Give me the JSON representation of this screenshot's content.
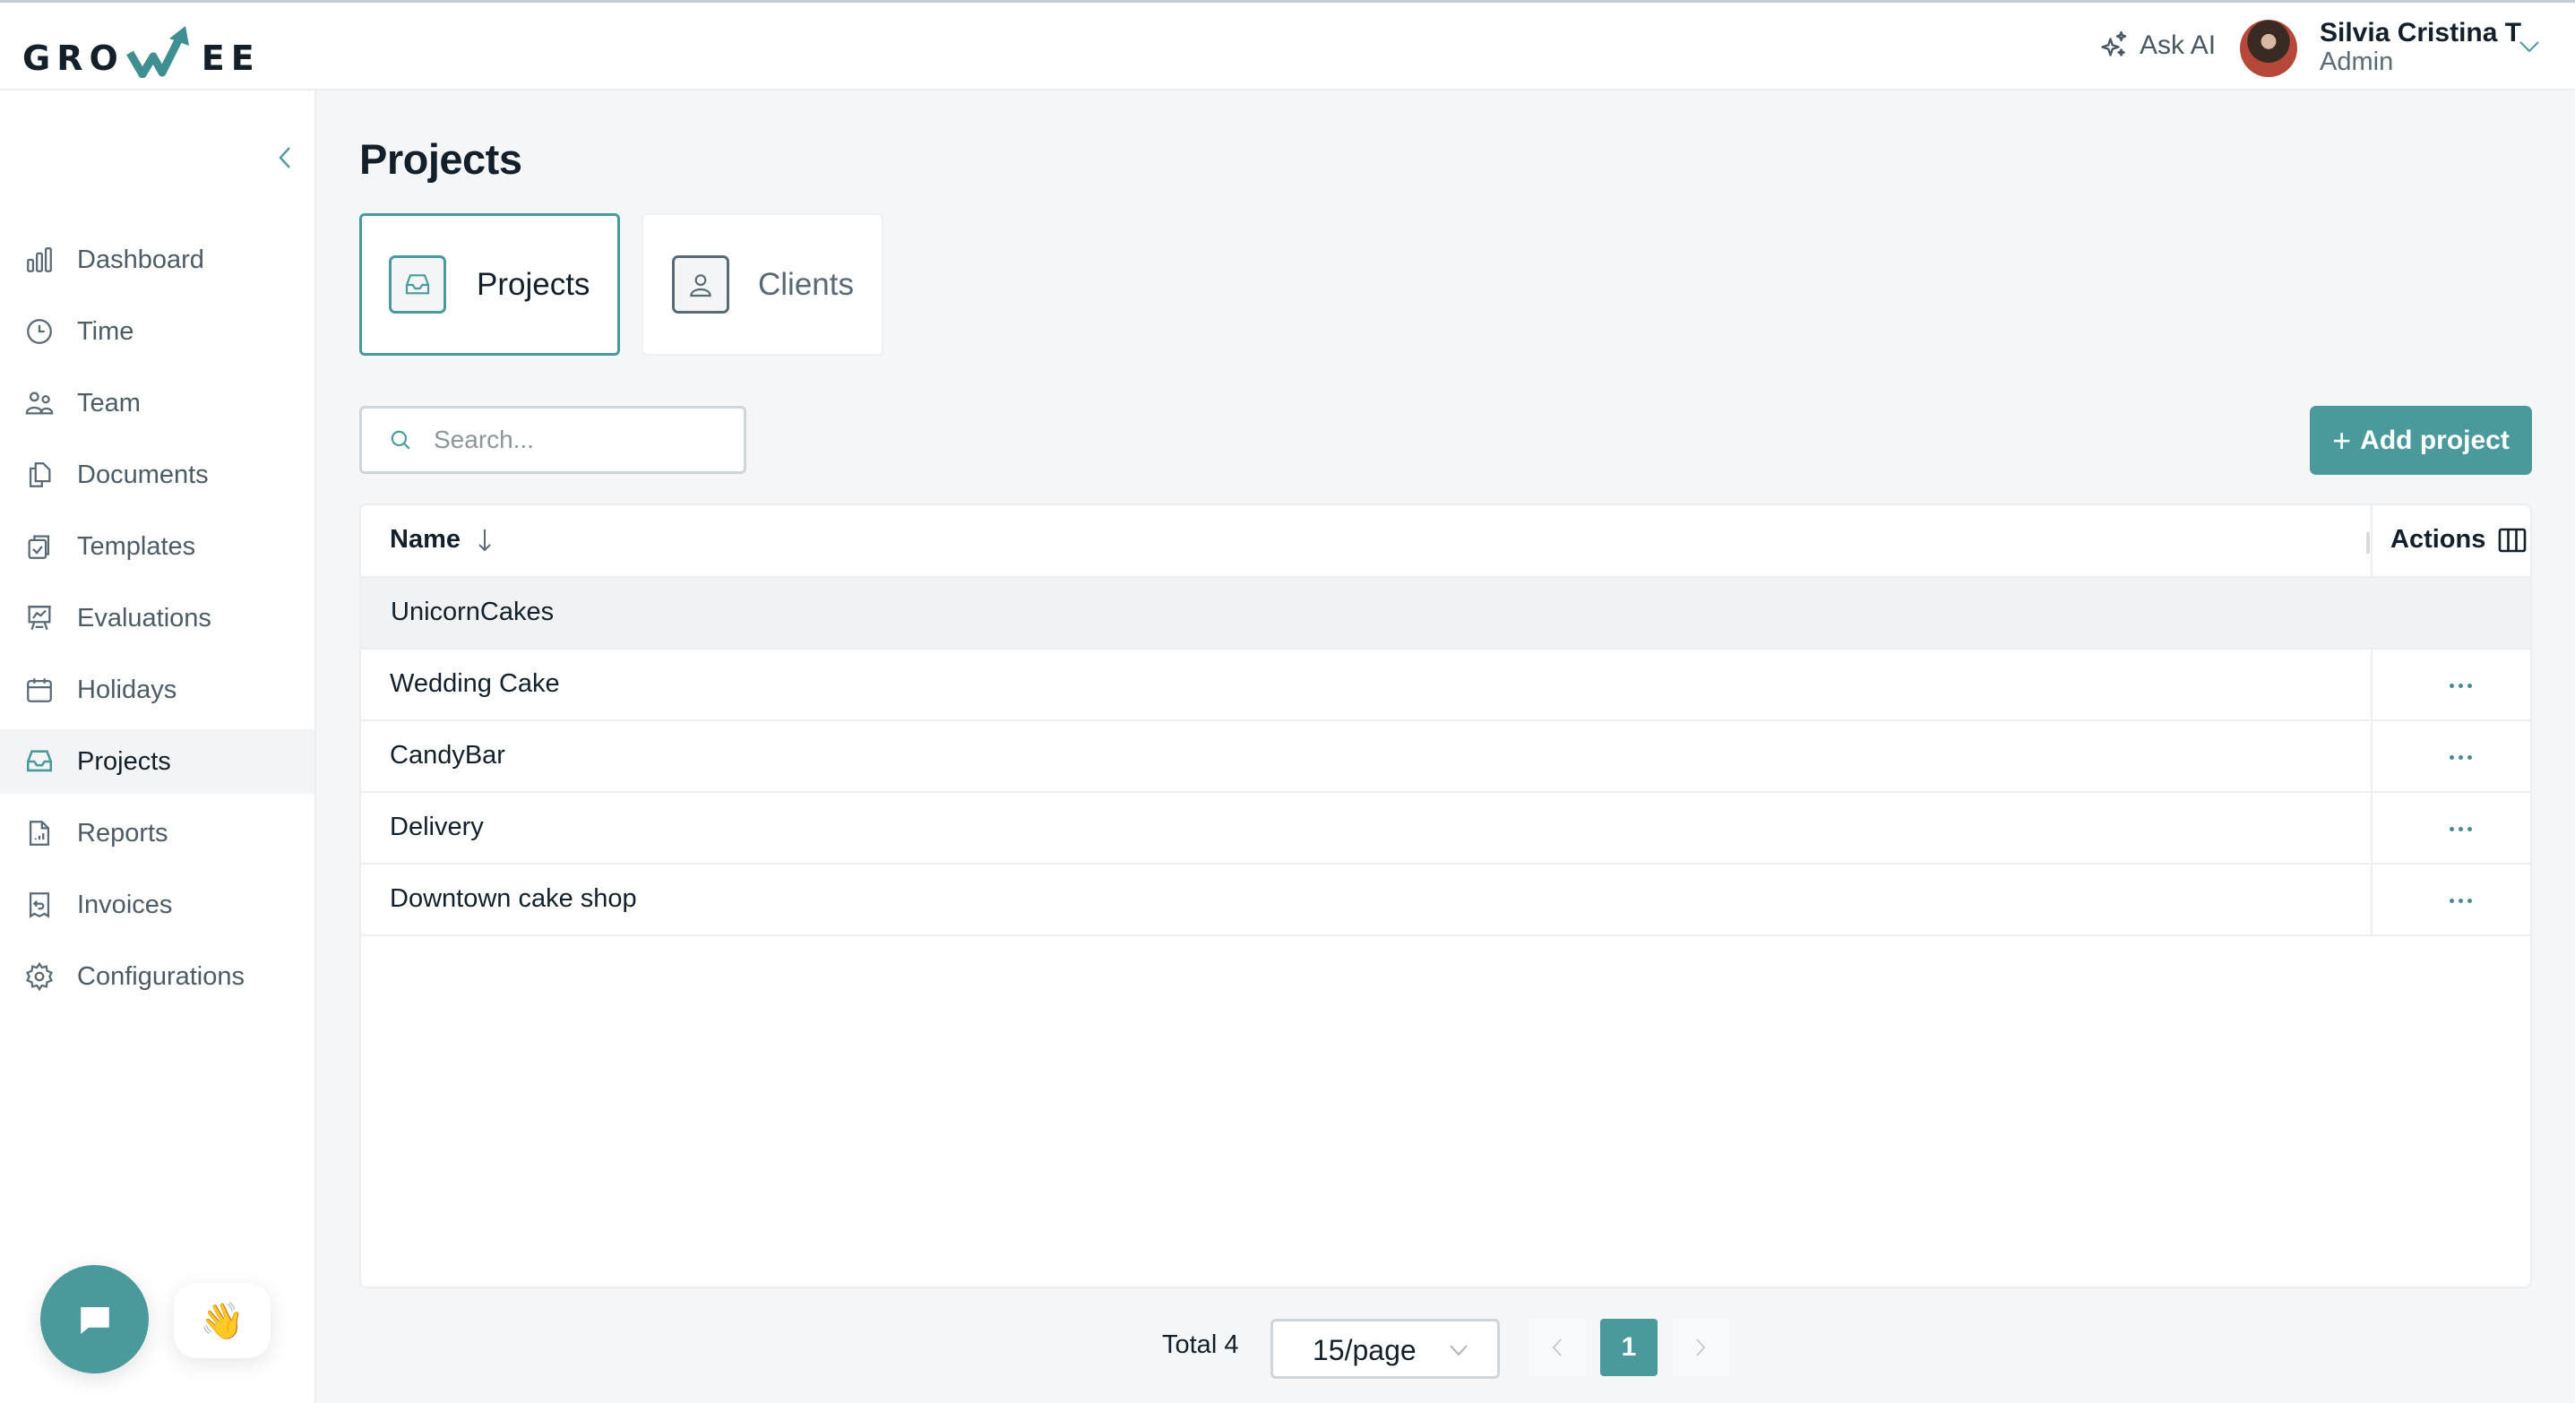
{
  "app": {
    "logo_left": "GRO",
    "logo_right": "EE",
    "logo_icon": "growth-arrow-icon"
  },
  "header": {
    "ask_ai_label": "Ask AI",
    "ask_ai_icon": "sparkles-icon",
    "user": {
      "name": "Silvia Cristina T",
      "role": "Admin"
    }
  },
  "sidebar": {
    "collapse_icon": "chevron-left-icon",
    "items": [
      {
        "label": "Dashboard",
        "icon": "bar-chart-icon",
        "active": false
      },
      {
        "label": "Time",
        "icon": "clock-icon",
        "active": false
      },
      {
        "label": "Team",
        "icon": "users-icon",
        "active": false
      },
      {
        "label": "Documents",
        "icon": "documents-icon",
        "active": false
      },
      {
        "label": "Templates",
        "icon": "clipboard-check-icon",
        "active": false
      },
      {
        "label": "Evaluations",
        "icon": "presentation-chart-icon",
        "active": false
      },
      {
        "label": "Holidays",
        "icon": "calendar-icon",
        "active": false
      },
      {
        "label": "Projects",
        "icon": "inbox-icon",
        "active": true
      },
      {
        "label": "Reports",
        "icon": "report-file-icon",
        "active": false
      },
      {
        "label": "Invoices",
        "icon": "receipt-icon",
        "active": false
      },
      {
        "label": "Configurations",
        "icon": "gear-icon",
        "active": false
      }
    ]
  },
  "main": {
    "title": "Projects",
    "tabs": [
      {
        "label": "Projects",
        "icon": "inbox-icon",
        "active": true
      },
      {
        "label": "Clients",
        "icon": "user-icon",
        "active": false
      }
    ],
    "search": {
      "placeholder": "Search...",
      "value": ""
    },
    "add_button_label": "Add project",
    "table": {
      "columns": [
        "Name",
        "Actions"
      ],
      "sort": {
        "column": "Name",
        "direction": "descending-arrow"
      },
      "groups": [
        {
          "name": "UnicornCakes",
          "rows": [
            "Wedding Cake",
            "CandyBar",
            "Delivery",
            "Downtown cake shop"
          ]
        }
      ]
    },
    "pagination": {
      "total_label": "Total 4",
      "page_size": "15/page",
      "current_page": "1"
    }
  },
  "colors": {
    "accent": "#4a9a9c",
    "text_primary": "#13202a",
    "text_secondary": "#4d5c64",
    "background": "#f5f6f8"
  },
  "widgets": {
    "chat_icon": "chat-bubble-icon",
    "wave_emoji": "👋"
  }
}
